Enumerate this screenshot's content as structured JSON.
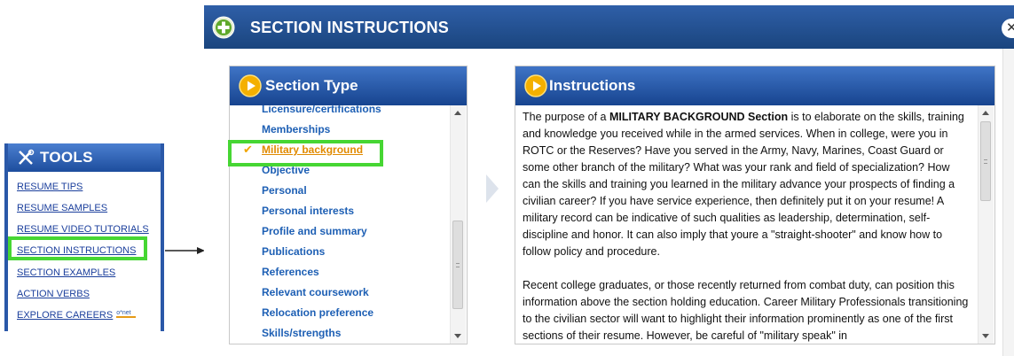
{
  "tools": {
    "title": "TOOLS",
    "links": [
      {
        "label": "RESUME TIPS"
      },
      {
        "label": "RESUME SAMPLES"
      },
      {
        "label": "RESUME VIDEO TUTORIALS"
      },
      {
        "label": "SECTION INSTRUCTIONS"
      },
      {
        "label": "SECTION EXAMPLES"
      },
      {
        "label": "ACTION VERBS"
      },
      {
        "label": "EXPLORE CAREERS",
        "badge": "o*net"
      }
    ]
  },
  "dialog": {
    "title": "SECTION INSTRUCTIONS",
    "close_glyph": "✕"
  },
  "section_type": {
    "title": "Section Type",
    "items": [
      {
        "label": "Licensure/certifications"
      },
      {
        "label": "Memberships"
      },
      {
        "label": "Military background",
        "selected": true
      },
      {
        "label": "Objective"
      },
      {
        "label": "Personal"
      },
      {
        "label": "Personal interests"
      },
      {
        "label": "Profile and summary"
      },
      {
        "label": "Publications"
      },
      {
        "label": "References"
      },
      {
        "label": "Relevant coursework"
      },
      {
        "label": "Relocation preference"
      },
      {
        "label": "Skills/strengths"
      }
    ],
    "check_glyph": "✔"
  },
  "instructions": {
    "title": "Instructions",
    "para1_before": "The purpose of a ",
    "para1_bold": "MILITARY BACKGROUND Section",
    "para1_after": " is to elaborate on the skills, training and knowledge you received while in the armed services. When in college, were you in ROTC or the Reserves? Have you served in the Army, Navy, Marines, Coast Guard or some other branch of the military? What was your rank and field of specialization? How can the skills and training you learned in the military advance your prospects of finding a civilian career? If you have service experience, then definitely put it on your resume! A military record can be indicative of such qualities as leadership, determination, self-discipline and honor. It can also imply that youre a \"straight-shooter\" and know how to follow policy and procedure.",
    "para2": "Recent college graduates, or those recently returned from combat duty, can position this information above the section holding education. Career Military Professionals transitioning to the civilian sector will want to highlight their information prominently as one of the first sections of their resume. However, be careful of \"military speak\" in"
  },
  "colors": {
    "header_blue": "#1a457e",
    "link_blue": "#1d5fb4",
    "selected_orange": "#e08a00",
    "highlight_green": "#46d633"
  }
}
